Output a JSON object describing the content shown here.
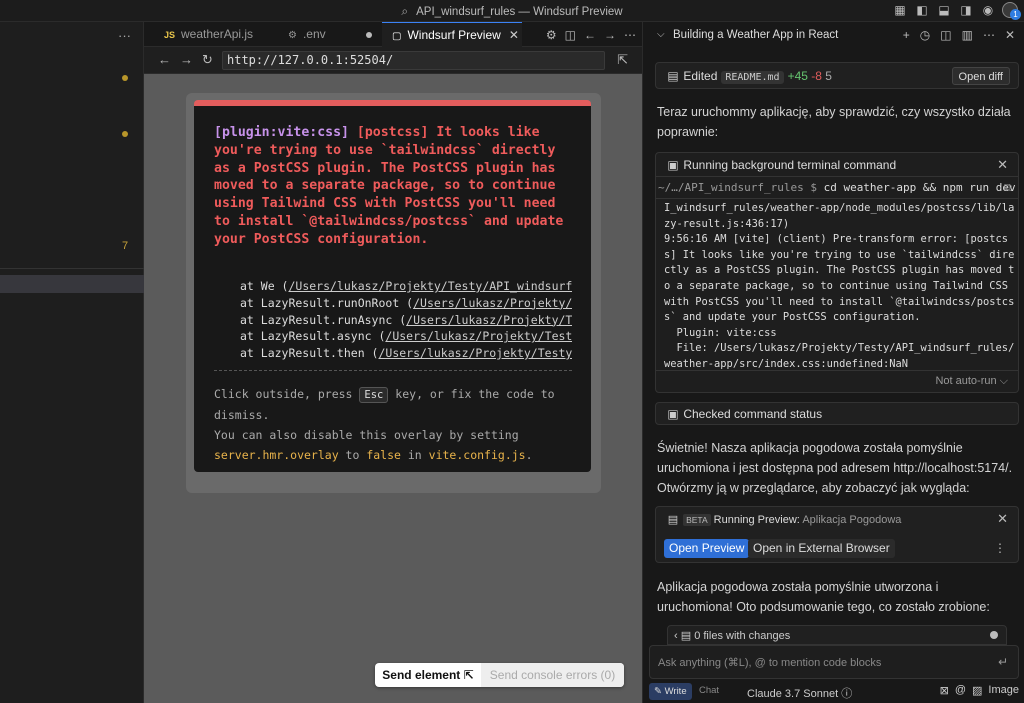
{
  "titlebar": {
    "title": "API_windsurf_rules — Windsurf Preview",
    "icons": [
      "search-icon",
      "layout-grid-icon",
      "toggle-sidebar-icon",
      "toggle-panel-icon",
      "toggle-secondary-icon",
      "windsurf-logo-icon",
      "account-icon"
    ],
    "badge": "1"
  },
  "explorer": {
    "more": "···",
    "line_number": "7"
  },
  "tabs": [
    {
      "label": "weatherApi.js",
      "icon": "JS"
    },
    {
      "label": ".env",
      "icon": "⚙"
    },
    {
      "label": "Windsurf Preview",
      "icon": "▢",
      "close": "✕"
    }
  ],
  "urlbar": {
    "back": "←",
    "forward": "→",
    "reload": "↻",
    "url": "http://127.0.0.1:52504/",
    "external": "⇱"
  },
  "error_overlay": {
    "plugin": "[plugin:vite:css]",
    "message": " [postcss] It looks like you're trying to use `tailwindcss` directly as a PostCSS plugin. The PostCSS plugin has moved to a separate package, so to continue using Tailwind CSS with PostCSS you'll need to install `@tailwindcss/postcss` and update your PostCSS configuration.",
    "stack": [
      {
        "fn": "at We (",
        "path": "/Users/lukasz/Projekty/Testy/API_windsurf_r"
      },
      {
        "fn": "at LazyResult.runOnRoot (",
        "path": "/Users/lukasz/Projekty/Te"
      },
      {
        "fn": "at LazyResult.runAsync (",
        "path": "/Users/lukasz/Projekty/Tes"
      },
      {
        "fn": "at LazyResult.async (",
        "path": "/Users/lukasz/Projekty/Testy/A"
      },
      {
        "fn": "at LazyResult.then (",
        "path": "/Users/lukasz/Projekty/Testy/A"
      }
    ],
    "tip_prefix": "Click outside, press ",
    "tip_key": "Esc",
    "tip_suffix": " key, or fix the code to dismiss.",
    "tip2_prefix": "You can also disable this overlay by setting ",
    "tip2_setting": "server.hmr.overlay",
    "tip2_mid": " to ",
    "tip2_value": "false",
    "tip2_in": " in ",
    "tip2_file": "vite.config.js",
    "tip2_end": "."
  },
  "sendbar": {
    "send_element": "Send element",
    "send_console": "Send console errors (0)"
  },
  "chat": {
    "title": "Building a Weather App in React",
    "edited": {
      "label": "Edited",
      "file": "README.md",
      "added": "+45",
      "removed": "-8",
      "count": "5",
      "open_diff": "Open diff"
    },
    "para1": "Teraz uruchommy aplikację, aby sprawdzić, czy wszystko działa poprawnie:",
    "terminal": {
      "title": "Running background terminal command",
      "prompt": "~/…/API_windsurf_rules $",
      "command": " cd weather-app && npm run dev",
      "output": "I_windsurf_rules/weather-app/node_modules/postcss/lib/lazy-result.js:436:17)\n9:56:16 AM [vite] (client) Pre-transform error: [postcss] It looks like you're trying to use `tailwindcss` directly as a PostCSS plugin. The PostCSS plugin has moved to a separate package, so to continue using Tailwind CSS with PostCSS you'll need to install `@tailwindcss/postcss` and update your PostCSS configuration.\n  Plugin: vite:css\n  File: /Users/lukasz/Projekty/Testy/API_windsurf_rules/weather-app/src/index.css:undefined:NaN",
      "footer": "Not auto-run ⌵"
    },
    "checked": "Checked command status",
    "para2": "Świetnie! Nasza aplikacja pogodowa została pomyślnie uruchomiona i jest dostępna pod adresem http://localhost:5174/. Otwórzmy ją w przeglądarce, aby zobaczyć jak wygląda:",
    "preview_card": {
      "beta": "BETA",
      "label": "Running Preview:",
      "sub": "Aplikacja Pogodowa",
      "open": "Open Preview",
      "external": "Open in External Browser"
    },
    "para3": "Aplikacja pogodowa została pomyślnie utworzona i uruchomiona! Oto podsumowanie tego, co zostało zrobione:",
    "files_changes": "0 files with changes",
    "ask_placeholder": "Ask anything (⌘L), @ to mention code blocks",
    "write": "Write",
    "chat_mode": "Chat",
    "model": "Claude 3.7 Sonnet",
    "image": "Image"
  }
}
